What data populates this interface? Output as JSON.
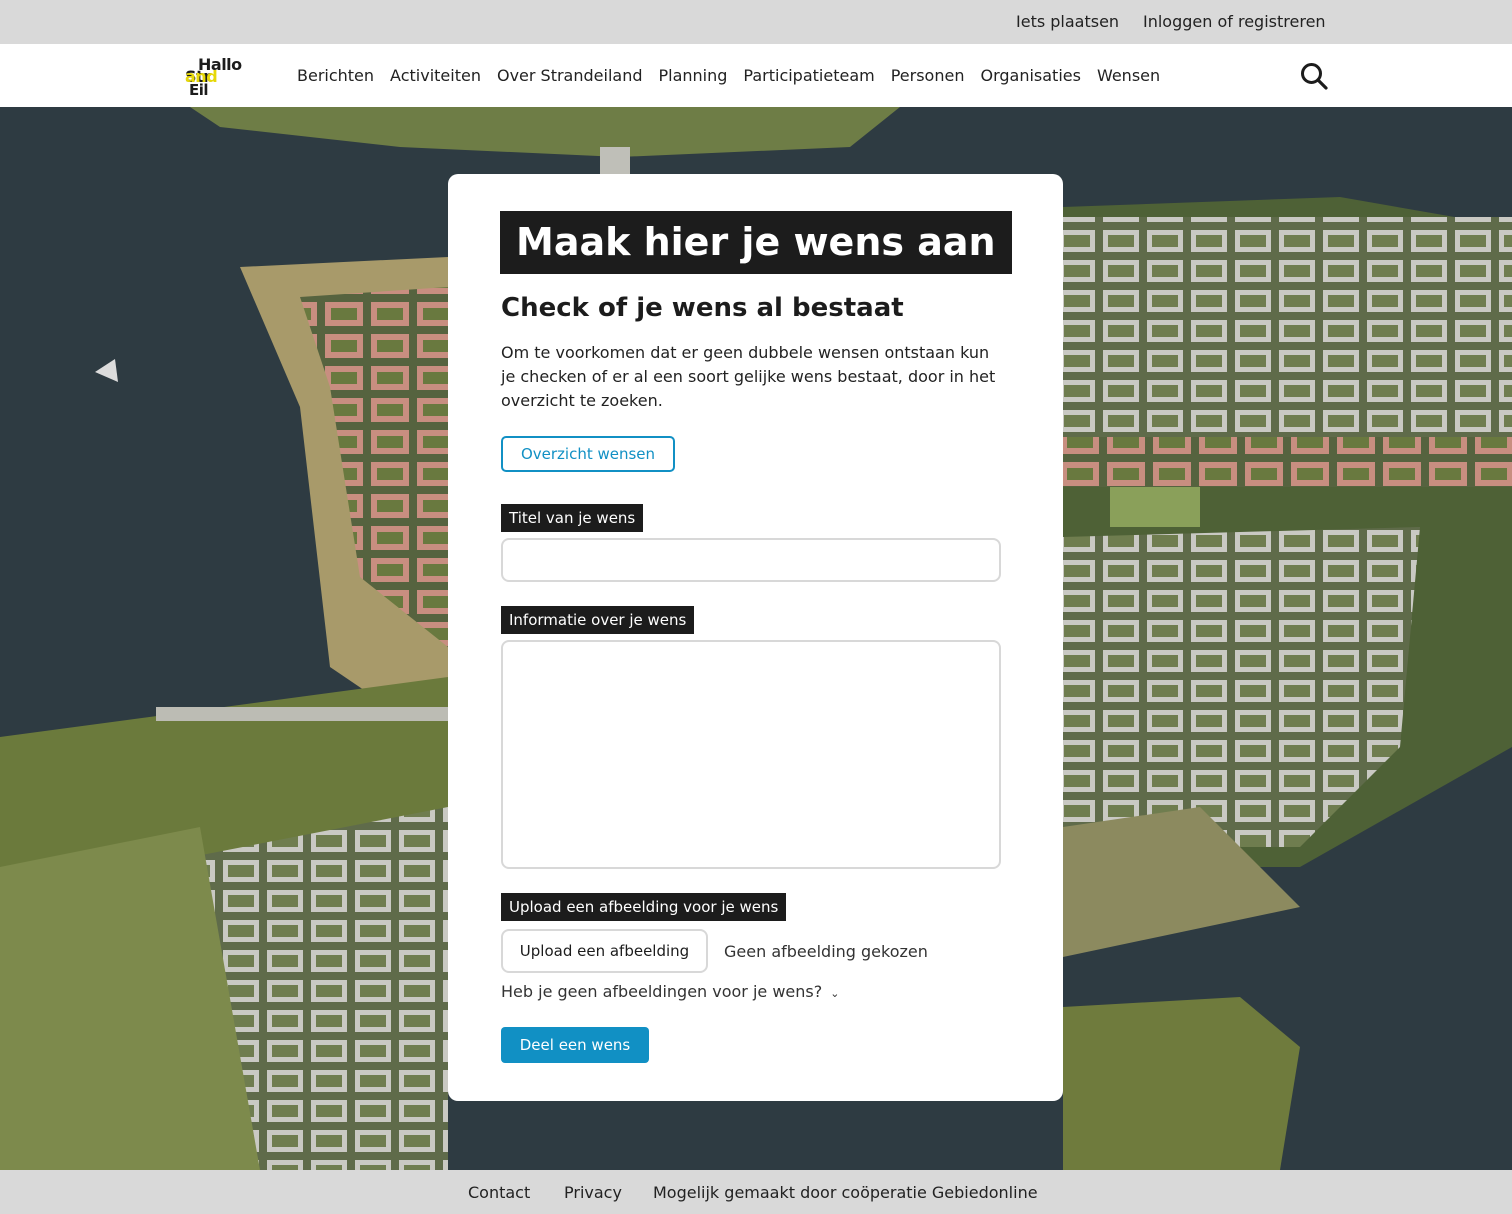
{
  "topbar": {
    "post_label": "Iets plaatsen",
    "login_label": "Inloggen of registreren"
  },
  "logo": {
    "line1": "Hallo",
    "line2a": "Str",
    "line2b": "and",
    "line3": "Eil"
  },
  "nav": {
    "items": [
      "Berichten",
      "Activiteiten",
      "Over Strandeiland",
      "Planning",
      "Participatieteam",
      "Personen",
      "Organisaties",
      "Wensen"
    ]
  },
  "form": {
    "heading": "Maak hier je wens aan",
    "subheading": "Check of je wens al bestaat",
    "description": "Om te voorkomen dat er geen dubbele wensen ontstaan kun je checken of er al een soort gelijke wens bestaat, door in het overzicht te zoeken.",
    "overview_button": "Overzicht wensen",
    "title_label": "Titel van je wens",
    "title_value": "",
    "info_label": "Informatie over je wens",
    "info_value": "",
    "upload_label": "Upload een afbeelding voor je wens",
    "upload_button": "Upload een afbeelding",
    "upload_status": "Geen afbeelding gekozen",
    "no_images_toggle": "Heb je geen afbeeldingen voor je wens?",
    "submit_button": "Deel een wens"
  },
  "footer": {
    "contact": "Contact",
    "privacy": "Privacy",
    "credit": "Mogelijk gemaakt door coöperatie Gebiedonline"
  },
  "colors": {
    "accent": "#1190c4",
    "dark": "#1c1c1c",
    "bar": "#d9d9d9",
    "logo_yellow": "#e6d80a"
  }
}
